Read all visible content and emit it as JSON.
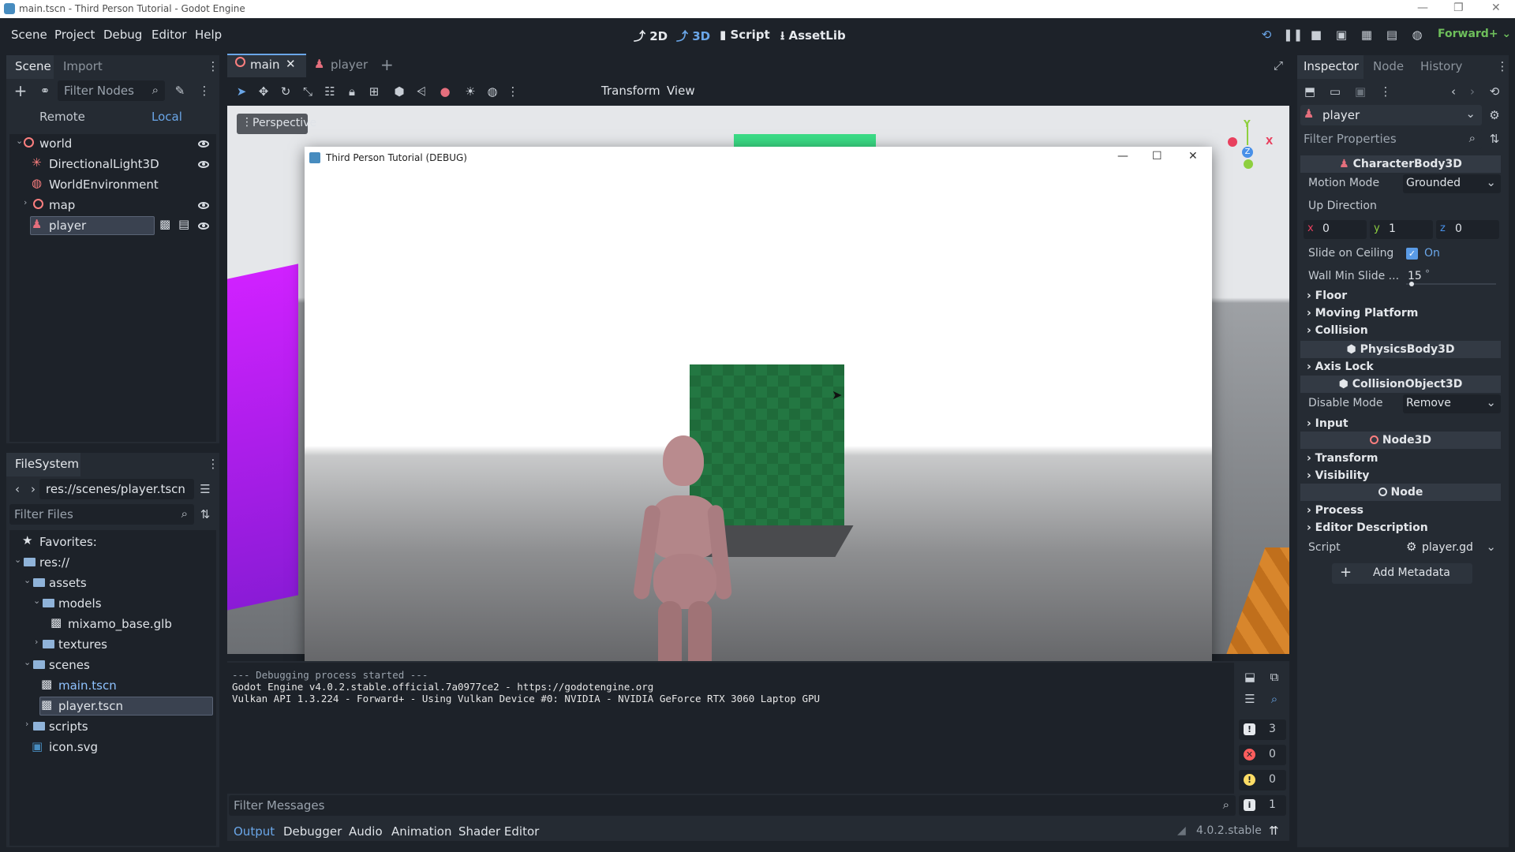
{
  "window": {
    "title": "main.tscn - Third Person Tutorial - Godot Engine"
  },
  "menu": [
    "Scene",
    "Project",
    "Debug",
    "Editor",
    "Help"
  ],
  "workspaces": [
    "2D",
    "3D",
    "Script",
    "AssetLib"
  ],
  "renderer": "Forward+",
  "scene_dock": {
    "tabs": [
      "Scene",
      "Import"
    ],
    "filter_placeholder": "Filter Nodes",
    "remote": "Remote",
    "local": "Local",
    "nodes": [
      "world",
      "DirectionalLight3D",
      "WorldEnvironment",
      "map",
      "player"
    ]
  },
  "filesystem": {
    "tab": "FileSystem",
    "path": "res://scenes/player.tscn",
    "filter_placeholder": "Filter Files",
    "items": [
      "Favorites:",
      "res://",
      "assets",
      "models",
      "mixamo_base.glb",
      "textures",
      "scenes",
      "main.tscn",
      "player.tscn",
      "scripts",
      "icon.svg"
    ]
  },
  "editor_tabs": [
    "main",
    "player"
  ],
  "viewport_toolbar": {
    "transform": "Transform",
    "view": "View",
    "perspective": "Perspective"
  },
  "game_window": {
    "title": "Third Person Tutorial (DEBUG)"
  },
  "output": {
    "lines": [
      "--- Debugging process started ---",
      "Godot Engine v4.0.2.stable.official.7a0977ce2 - https://godotengine.org",
      "Vulkan API 1.3.224 - Forward+ - Using Vulkan Device #0: NVIDIA - NVIDIA GeForce RTX 3060 Laptop GPU"
    ],
    "filter_placeholder": "Filter Messages",
    "counts": [
      "3",
      "0",
      "0",
      "1"
    ]
  },
  "bottom_tabs": [
    "Output",
    "Debugger",
    "Audio",
    "Animation",
    "Shader Editor"
  ],
  "version": "4.0.2.stable",
  "inspector": {
    "tabs": [
      "Inspector",
      "Node",
      "History"
    ],
    "object": "player",
    "filter_placeholder": "Filter Properties",
    "sections": {
      "character": "CharacterBody3D",
      "physics": "PhysicsBody3D",
      "collision_object": "CollisionObject3D",
      "node3d": "Node3D",
      "node": "Node"
    },
    "props": {
      "motion_mode_label": "Motion Mode",
      "motion_mode": "Grounded",
      "up_direction": "Up Direction",
      "x_label": "x",
      "x": "0",
      "y_label": "y",
      "y": "1",
      "z_label": "z",
      "z": "0",
      "slide_label": "Slide on Ceiling",
      "slide_value": "On",
      "wall_label": "Wall Min Slide ...",
      "wall_value": "15",
      "wall_unit": "°",
      "disable_mode_label": "Disable Mode",
      "disable_mode": "Remove",
      "script_label": "Script",
      "script_value": "player.gd",
      "add_metadata": "Add Metadata"
    },
    "groups": [
      "Floor",
      "Moving Platform",
      "Collision",
      "Axis Lock",
      "Input",
      "Transform",
      "Visibility",
      "Process",
      "Editor Description"
    ]
  },
  "colors": {
    "accent": "#6aa6e8",
    "player_icon": "#e56f7d",
    "node_icon": "#fc7f7f",
    "bg": "#1d2229",
    "panel": "#252b33"
  }
}
